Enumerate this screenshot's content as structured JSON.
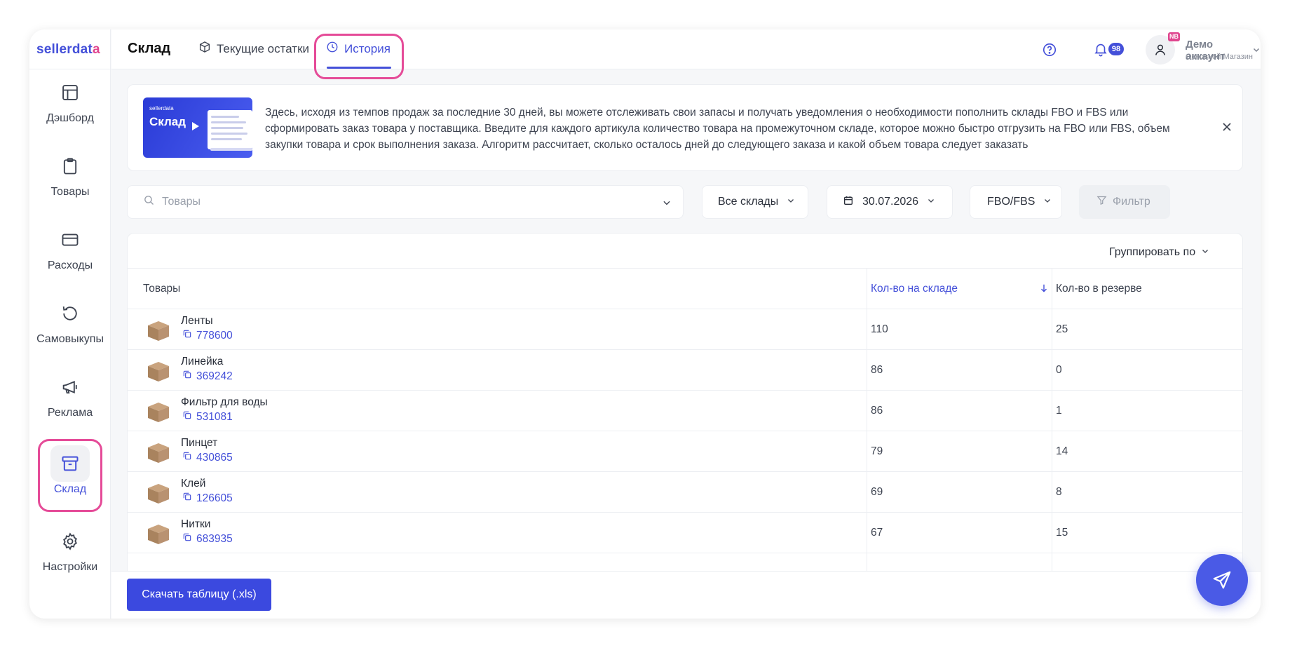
{
  "app": {
    "logo_main": "sellerdat",
    "logo_accent": "a"
  },
  "sidebar": {
    "items": [
      {
        "label": "Дэшборд",
        "icon": "dashboard-icon"
      },
      {
        "label": "Товары",
        "icon": "clipboard-icon"
      },
      {
        "label": "Расходы",
        "icon": "card-icon"
      },
      {
        "label": "Самовыкупы",
        "icon": "undo-icon"
      },
      {
        "label": "Реклама",
        "icon": "megaphone-icon"
      },
      {
        "label": "Склад",
        "icon": "archive-icon",
        "active": true
      },
      {
        "label": "Настройки",
        "icon": "gear-icon"
      }
    ]
  },
  "header": {
    "title": "Склад",
    "tabs": [
      {
        "label": "Текущие остатки",
        "icon": "box-icon"
      },
      {
        "label": "История",
        "icon": "clock-icon",
        "active": true
      }
    ],
    "notifications_count": "98",
    "account_badge": "NB",
    "account_name": "Демо аккаунт",
    "account_sub": "Основной Магазин"
  },
  "banner": {
    "thumb_brand": "sellerdata",
    "thumb_title": "Склад",
    "text": "Здесь, исходя из темпов продаж за последние 30 дней, вы можете отслеживать свои запасы и получать уведомления о необходимости пополнить склады FBO и FBS или сформировать заказ товара у поставщика. Введите для каждого артикула количество товара на промежуточном складе, которое можно быстро отгрузить на FBO или FBS, объем закупки товара и срок выполнения заказа. Алгоритм рассчитает, сколько осталось дней до следующего заказа и какой объем товара следует заказать"
  },
  "filters": {
    "search_placeholder": "Товары",
    "warehouse": "Все склады",
    "date": "30.07.2026",
    "type": "FBO/FBS",
    "filter_label": "Фильтр"
  },
  "table": {
    "group_by": "Группировать по",
    "columns": {
      "product": "Товары",
      "qty": "Кол-во на складе",
      "reserve": "Кол-во в резерве"
    },
    "rows": [
      {
        "name": "Ленты",
        "sku": "778600",
        "qty": "110",
        "reserve": "25"
      },
      {
        "name": "Линейка",
        "sku": "369242",
        "qty": "86",
        "reserve": "0"
      },
      {
        "name": "Фильтр для воды",
        "sku": "531081",
        "qty": "86",
        "reserve": "1"
      },
      {
        "name": "Пинцет",
        "sku": "430865",
        "qty": "79",
        "reserve": "14"
      },
      {
        "name": "Клей",
        "sku": "126605",
        "qty": "69",
        "reserve": "8"
      },
      {
        "name": "Нитки",
        "sku": "683935",
        "qty": "67",
        "reserve": "15"
      }
    ]
  },
  "footer": {
    "download_label": "Скачать таблицу (.xls)"
  },
  "colors": {
    "accent": "#4450d9",
    "highlight": "#e54b98",
    "button": "#3b49df"
  }
}
